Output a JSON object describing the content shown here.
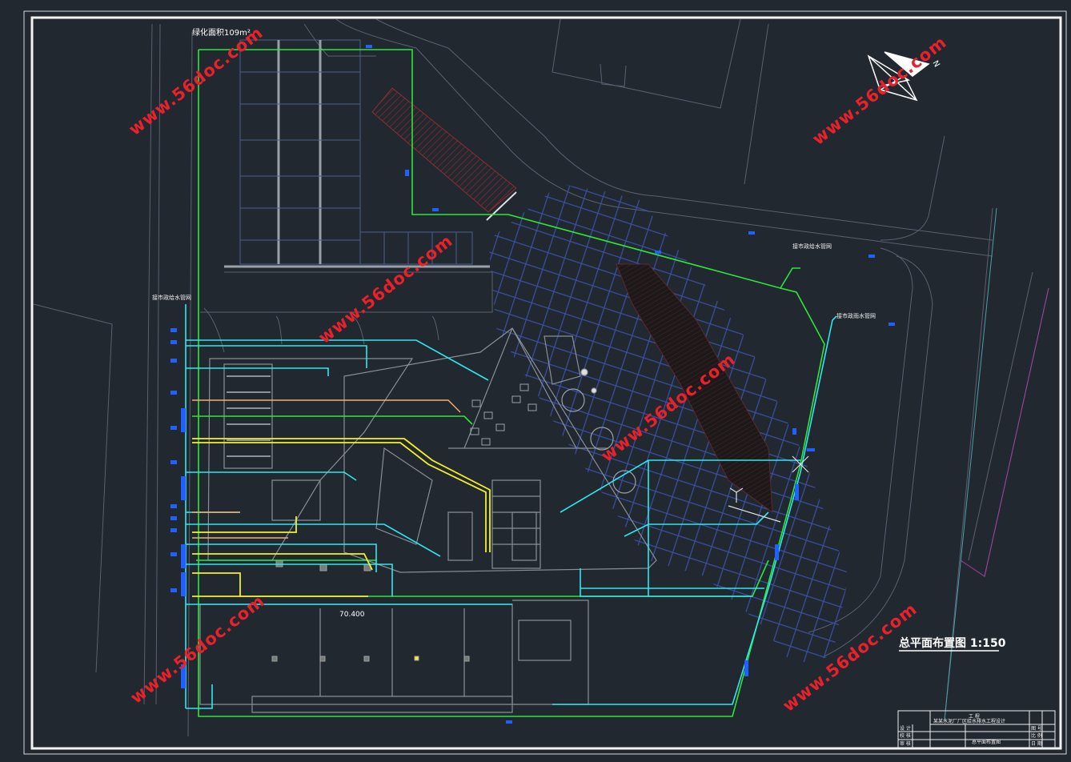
{
  "drawing": {
    "title": "总平面布置图 1:150",
    "area_label": "绿化面积109m²",
    "elevation_label": "70.400",
    "labels": {
      "west_pipe": "接市政给水管网",
      "northeast_pipe": "接市政给水管网",
      "east_pipe": "接市政雨水管网"
    },
    "north_arrow_label": "N"
  },
  "watermarks": [
    "www.56doc.com",
    "www.56doc.com",
    "www.56doc.com",
    "www.56doc.com",
    "www.56doc.com",
    "www.56doc.com",
    "www.56doc.com"
  ],
  "title_block": {
    "header": "工  程",
    "project": "某某水泥厂厂区给水排水工程设计",
    "drawing_name": "总平面布置图",
    "rows": [
      "设 计",
      "校 核",
      "审 核"
    ],
    "right_cols": [
      "图 号",
      "比 例",
      "日 期"
    ]
  },
  "colors": {
    "background": "#212830",
    "frame": "#f0f0f0",
    "green": "#2ee63a",
    "cyan": "#2ee8ee",
    "yellow": "#f4f02a",
    "orange": "#f0b070",
    "blue": "#2060ff",
    "grid": "#3a4fa0",
    "building": "#8a8f96",
    "watermark": "#e8212b"
  }
}
